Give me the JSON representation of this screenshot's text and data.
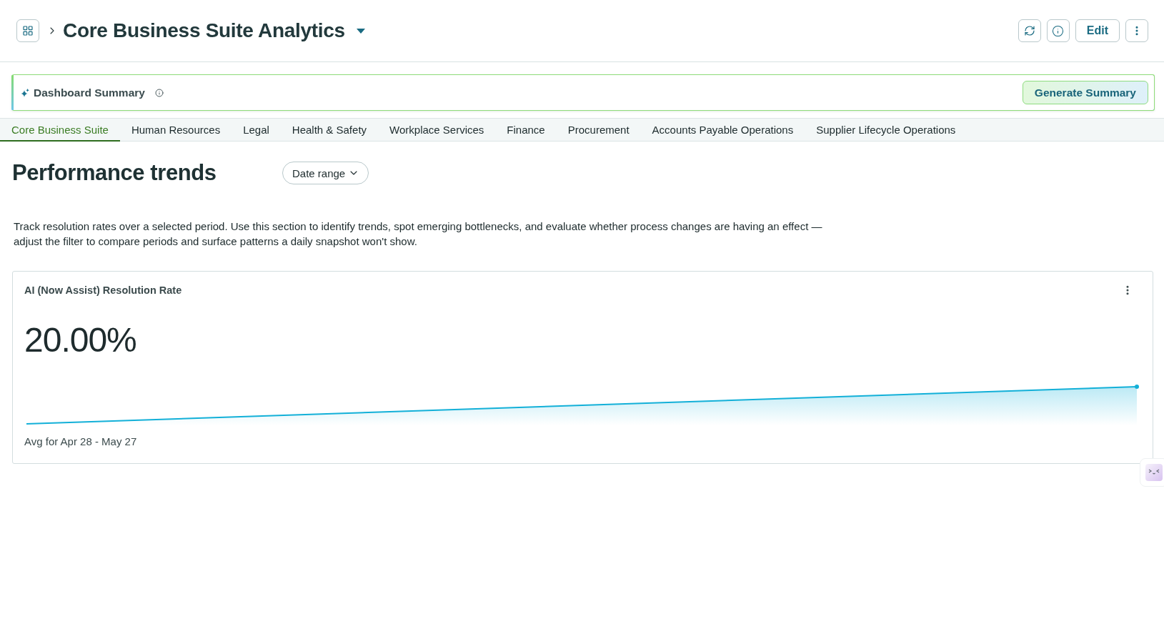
{
  "header": {
    "title": "Core Business Suite Analytics",
    "edit_button": "Edit"
  },
  "summary_bar": {
    "title": "Dashboard Summary",
    "button": "Generate Summary"
  },
  "tabs": [
    {
      "label": "Core Business Suite",
      "selected": true
    },
    {
      "label": "Human Resources",
      "selected": false
    },
    {
      "label": "Legal",
      "selected": false
    },
    {
      "label": "Health & Safety",
      "selected": false
    },
    {
      "label": "Workplace Services",
      "selected": false
    },
    {
      "label": "Finance",
      "selected": false
    },
    {
      "label": "Procurement",
      "selected": false
    },
    {
      "label": "Accounts Payable Operations",
      "selected": false
    },
    {
      "label": "Supplier Lifecycle Operations",
      "selected": false
    }
  ],
  "section": {
    "title": "Performance trends",
    "filter": "Date range",
    "description": "Track resolution rates over a selected period. Use this section to identify trends, spot emerging bottlenecks, and evaluate whether process changes are having an effect — adjust the filter to compare periods and surface patterns a daily snapshot won't show."
  },
  "card": {
    "title": "AI (Now Assist) Resolution Rate",
    "value": "20.00%",
    "footnote": "Avg for Apr 28 - May 27"
  }
}
